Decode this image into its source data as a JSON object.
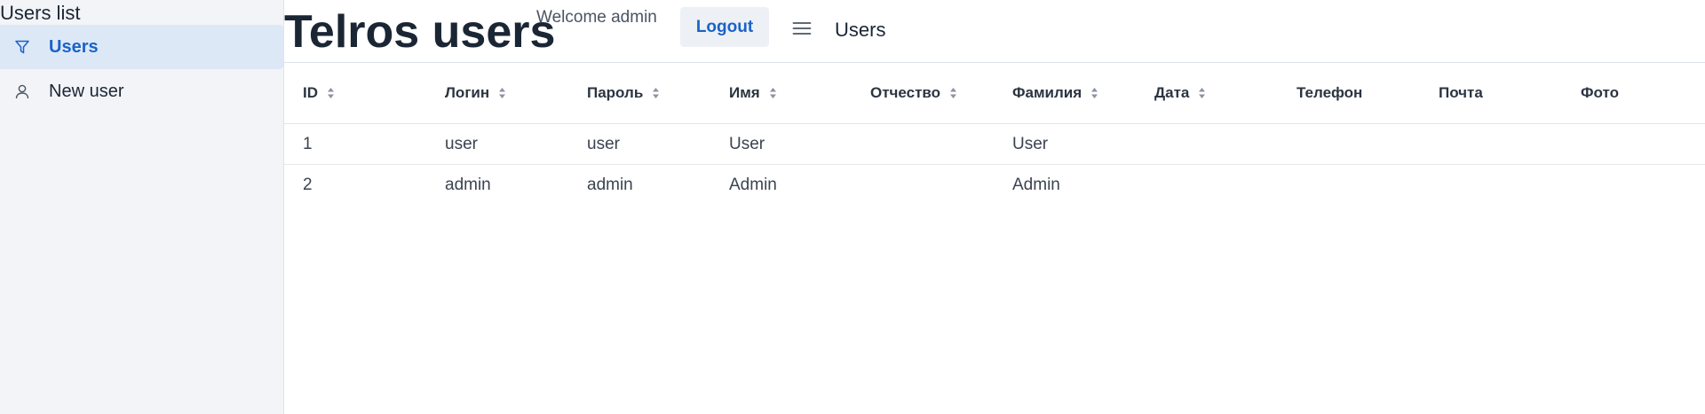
{
  "sidebar": {
    "title": "Users list",
    "items": [
      {
        "label": "Users",
        "icon": "filter-icon",
        "active": true
      },
      {
        "label": "New user",
        "icon": "user-icon",
        "active": false
      }
    ]
  },
  "header": {
    "app_title": "Telros users",
    "welcome": "Welcome admin",
    "logout_label": "Logout",
    "menu_icon": "hamburger-menu-icon",
    "page_title": "Users"
  },
  "table": {
    "columns": [
      {
        "label": "ID",
        "sortable": true
      },
      {
        "label": "Логин",
        "sortable": true
      },
      {
        "label": "Пароль",
        "sortable": true
      },
      {
        "label": "Имя",
        "sortable": true
      },
      {
        "label": "Отчество",
        "sortable": true
      },
      {
        "label": "Фамилия",
        "sortable": true
      },
      {
        "label": "Дата",
        "sortable": true
      },
      {
        "label": "Телефон",
        "sortable": false
      },
      {
        "label": "Почта",
        "sortable": false
      },
      {
        "label": "Фото",
        "sortable": false
      }
    ],
    "rows": [
      [
        "1",
        "user",
        "user",
        "User",
        "",
        "User",
        "",
        "",
        "",
        ""
      ],
      [
        "2",
        "admin",
        "admin",
        "Admin",
        "",
        "Admin",
        "",
        "",
        "",
        ""
      ]
    ]
  },
  "colors": {
    "accent": "#1a63c7",
    "sidebar_bg": "#f2f4f7",
    "active_item_bg": "#dde8f7",
    "logout_bg": "#edf1f5"
  }
}
